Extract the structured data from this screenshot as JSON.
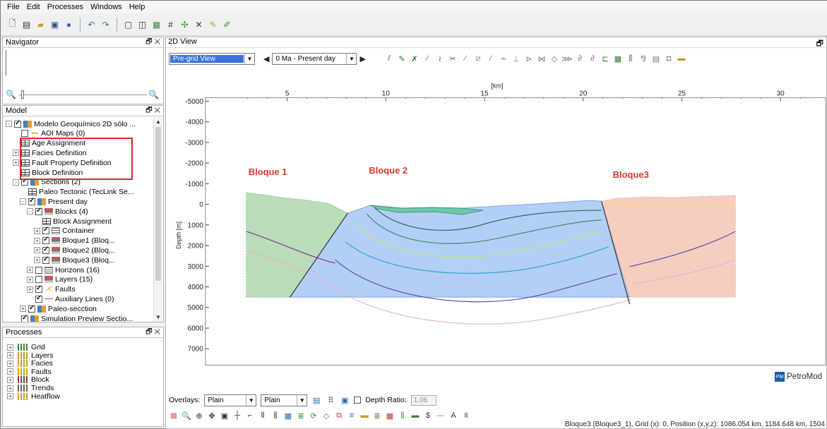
{
  "menu": [
    "File",
    "Edit",
    "Processes",
    "Windows",
    "Help"
  ],
  "panels": {
    "navigator_title": "Navigator",
    "model_title": "Model",
    "processes_title": "Processes",
    "view_title": "2D View"
  },
  "tree": [
    {
      "label": "Modelo Geoquímico 2D sólo ...",
      "indent": 0,
      "expand": "-",
      "check": true,
      "icon": "model"
    },
    {
      "label": "AOI Maps (0)",
      "indent": 1,
      "expand": "",
      "check": false,
      "icon": "aoi"
    },
    {
      "label": "Age Assignment",
      "indent": 1,
      "expand": "",
      "check": null,
      "icon": "table"
    },
    {
      "label": "Facies Definition",
      "indent": 1,
      "expand": "+",
      "check": null,
      "icon": "table"
    },
    {
      "label": "Fault Property Definition",
      "indent": 1,
      "expand": "+",
      "check": null,
      "icon": "table"
    },
    {
      "label": "Block Definition",
      "indent": 1,
      "expand": "",
      "check": null,
      "icon": "table"
    },
    {
      "label": "Sections (2)",
      "indent": 1,
      "expand": "-",
      "check": true,
      "icon": "model"
    },
    {
      "label": "Paleo Tectonic (TecLink Se...",
      "indent": 2,
      "expand": "",
      "check": null,
      "icon": "table"
    },
    {
      "label": "Present day",
      "indent": 2,
      "expand": "-",
      "check": true,
      "icon": "model"
    },
    {
      "label": "Blocks (4)",
      "indent": 3,
      "expand": "-",
      "check": true,
      "icon": "block"
    },
    {
      "label": "Block Assignment",
      "indent": 4,
      "expand": "",
      "check": null,
      "icon": "table"
    },
    {
      "label": "Container",
      "indent": 4,
      "expand": "+",
      "check": true,
      "icon": "lines"
    },
    {
      "label": "Bloque1 (Bloq...",
      "indent": 4,
      "expand": "+",
      "check": true,
      "icon": "block"
    },
    {
      "label": "Bloque2 (Bloq...",
      "indent": 4,
      "expand": "+",
      "check": true,
      "icon": "block"
    },
    {
      "label": "Bloque3 (Bloq...",
      "indent": 4,
      "expand": "+",
      "check": true,
      "icon": "block"
    },
    {
      "label": "Horizons (16)",
      "indent": 3,
      "expand": "+",
      "check": false,
      "icon": "lines"
    },
    {
      "label": "Layers (15)",
      "indent": 3,
      "expand": "+",
      "check": false,
      "icon": "block"
    },
    {
      "label": "Faults",
      "indent": 3,
      "expand": "+",
      "check": true,
      "icon": "fault"
    },
    {
      "label": "Auxiliary Lines (0)",
      "indent": 3,
      "expand": "",
      "check": true,
      "icon": "aux"
    },
    {
      "label": "Paleo-secction",
      "indent": 2,
      "expand": "+",
      "check": true,
      "icon": "model"
    },
    {
      "label": "Simulation Preview Sectio...",
      "indent": 1,
      "expand": "",
      "check": true,
      "icon": "model"
    }
  ],
  "processes": [
    "Grid",
    "Layers",
    "Facies",
    "Faults",
    "Block",
    "Trends",
    "Heatflow"
  ],
  "view_toolbar": {
    "view_mode": "Pre-grid View",
    "age": "0 Ma - Present day"
  },
  "plot": {
    "x_unit": "[km]",
    "y_label": "Depth [m]",
    "x_ticks": [
      5,
      10,
      15,
      20,
      25,
      30
    ],
    "y_ticks": [
      "-5000",
      "-4000",
      "-3000",
      "-2000",
      "-1000",
      "0",
      "1000",
      "2000",
      "3000",
      "4000",
      "5000",
      "6000",
      "7000"
    ],
    "block_labels": [
      "Bloque 1",
      "Bloque 2",
      "Bloque3"
    ],
    "colors": {
      "bloque1": "#b9dcb9",
      "bloque2": "#b4cff5",
      "bloque3": "#f7cdbf",
      "label": "#d43a2c"
    }
  },
  "brand": "PetroMod",
  "overlays": {
    "label": "Overlays:",
    "first": "Plain",
    "second": "Plain",
    "depth_ratio_label": "Depth Ratio:",
    "depth_ratio_value": "1.06"
  },
  "status": "Bloque3 (Bloque3_1), Grid (x): 0, Position (x,y,z): 1086.054 km, 1184.648 km, 1504"
}
